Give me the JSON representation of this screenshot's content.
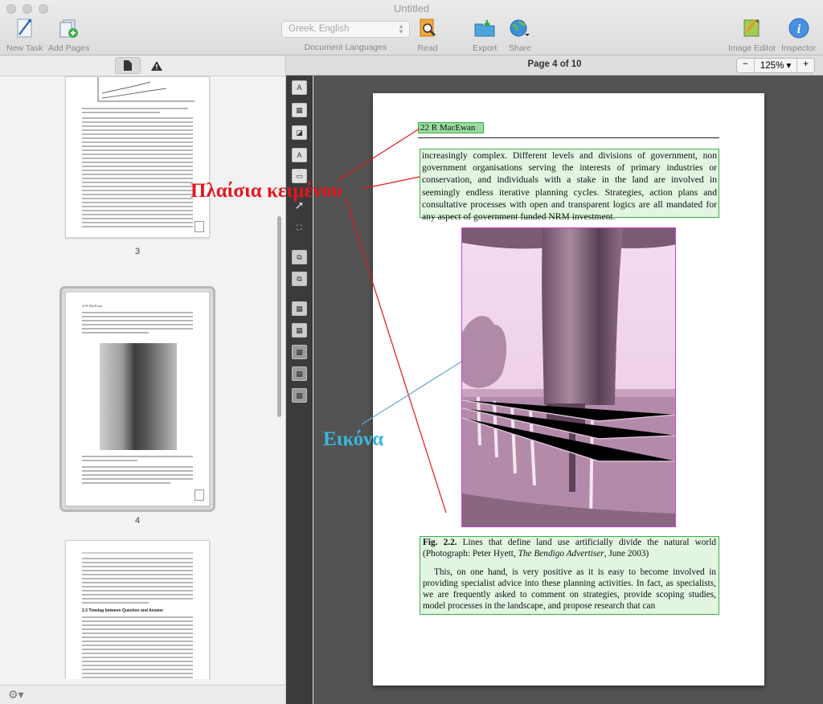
{
  "window": {
    "title": "Untitled"
  },
  "toolbar": {
    "new_task": "New Task",
    "add_pages": "Add Pages",
    "language_value": "Greek, English",
    "document_languages": "Document Languages",
    "read": "Read",
    "export": "Export",
    "share": "Share",
    "image_editor": "Image Editor",
    "inspector": "Inspector"
  },
  "sidebar": {
    "thumbnails": [
      {
        "number": "3"
      },
      {
        "number": "4"
      },
      {
        "number": ""
      }
    ],
    "thumb_page4_header": "22   R MacEwan",
    "thumb_page5_heading": "2.3 Timelag between Question and Answer"
  },
  "viewer": {
    "page_indicator": "Page 4 of 10",
    "zoom_minus": "−",
    "zoom_value": "125% ▾",
    "zoom_plus": "+"
  },
  "document": {
    "header": "22     R MacEwan",
    "paragraph1": "increasingly complex. Different levels and divisions of government, non government organisations serving the interests of primary industries or conservation, and individuals with a stake in the land are involved in seemingly endless iterative planning cycles. Strategies, action plans and consultative processes with open and transparent logics are all mandated for any aspect of government funded NRM investment.",
    "caption_label": "Fig. 2.2.",
    "caption_text": " Lines that define land use artificially divide the natural world (Photograph: Peter Hyett, ",
    "caption_source": "The Bendigo Advertiser",
    "caption_end": ", June 2003)",
    "paragraph2": "This, on one hand, is very positive as it is easy to become involved in providing specialist advice into these planning activities. In fact, as specialists, we are frequently asked to comment on strategies, provide scoping studies, model processes in the landscape, and propose research that can"
  },
  "annotations": {
    "text_boxes": "Πλαίσια κειμένου",
    "image": "Εικόνα",
    "text_color": "#e2171b",
    "image_color": "#3ab6dc"
  },
  "colors": {
    "text_zone": "#3eae4a",
    "image_zone": "#d23ed8"
  }
}
